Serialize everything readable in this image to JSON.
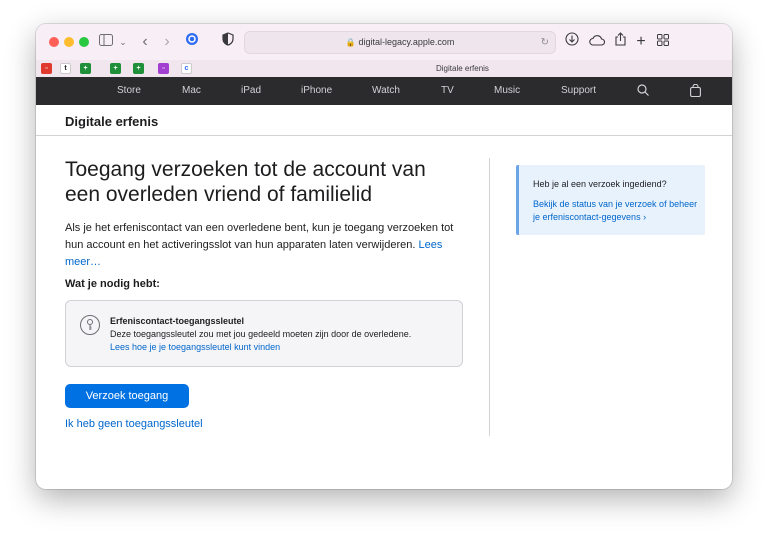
{
  "browser": {
    "address": "digital-legacy.apple.com",
    "tab_title": "Digitale erfenis"
  },
  "nav": {
    "items": [
      "Store",
      "Mac",
      "iPad",
      "iPhone",
      "Watch",
      "TV",
      "Music",
      "Support"
    ]
  },
  "page": {
    "header": "Digitale erfenis",
    "title": "Toegang verzoeken tot de account van een overleden vriend of familielid",
    "intro": "Als je het erfeniscontact van een overledene bent, kun je toegang verzoeken tot hun account en het activeringsslot van hun apparaten laten verwijderen.",
    "intro_link": "Lees meer…",
    "need_heading": "Wat je nodig hebt:",
    "card": {
      "title": "Erfeniscontact-toegangssleutel",
      "desc": "Deze toegangssleutel zou met jou gedeeld moeten zijn door de overledene.",
      "link": "Lees hoe je je toegangssleutel kunt vinden"
    },
    "button": "Verzoek toegang",
    "no_key_link": "Ik heb geen toegangssleutel"
  },
  "sidebar": {
    "question": "Heb je al een verzoek ingediend?",
    "link": "Bekijk de status van je verzoek of beheer je erfeniscontact-gegevens ›"
  },
  "colors": {
    "accent": "#0071e3",
    "link": "#0066cc",
    "nav_bg": "#2b2b2d"
  }
}
